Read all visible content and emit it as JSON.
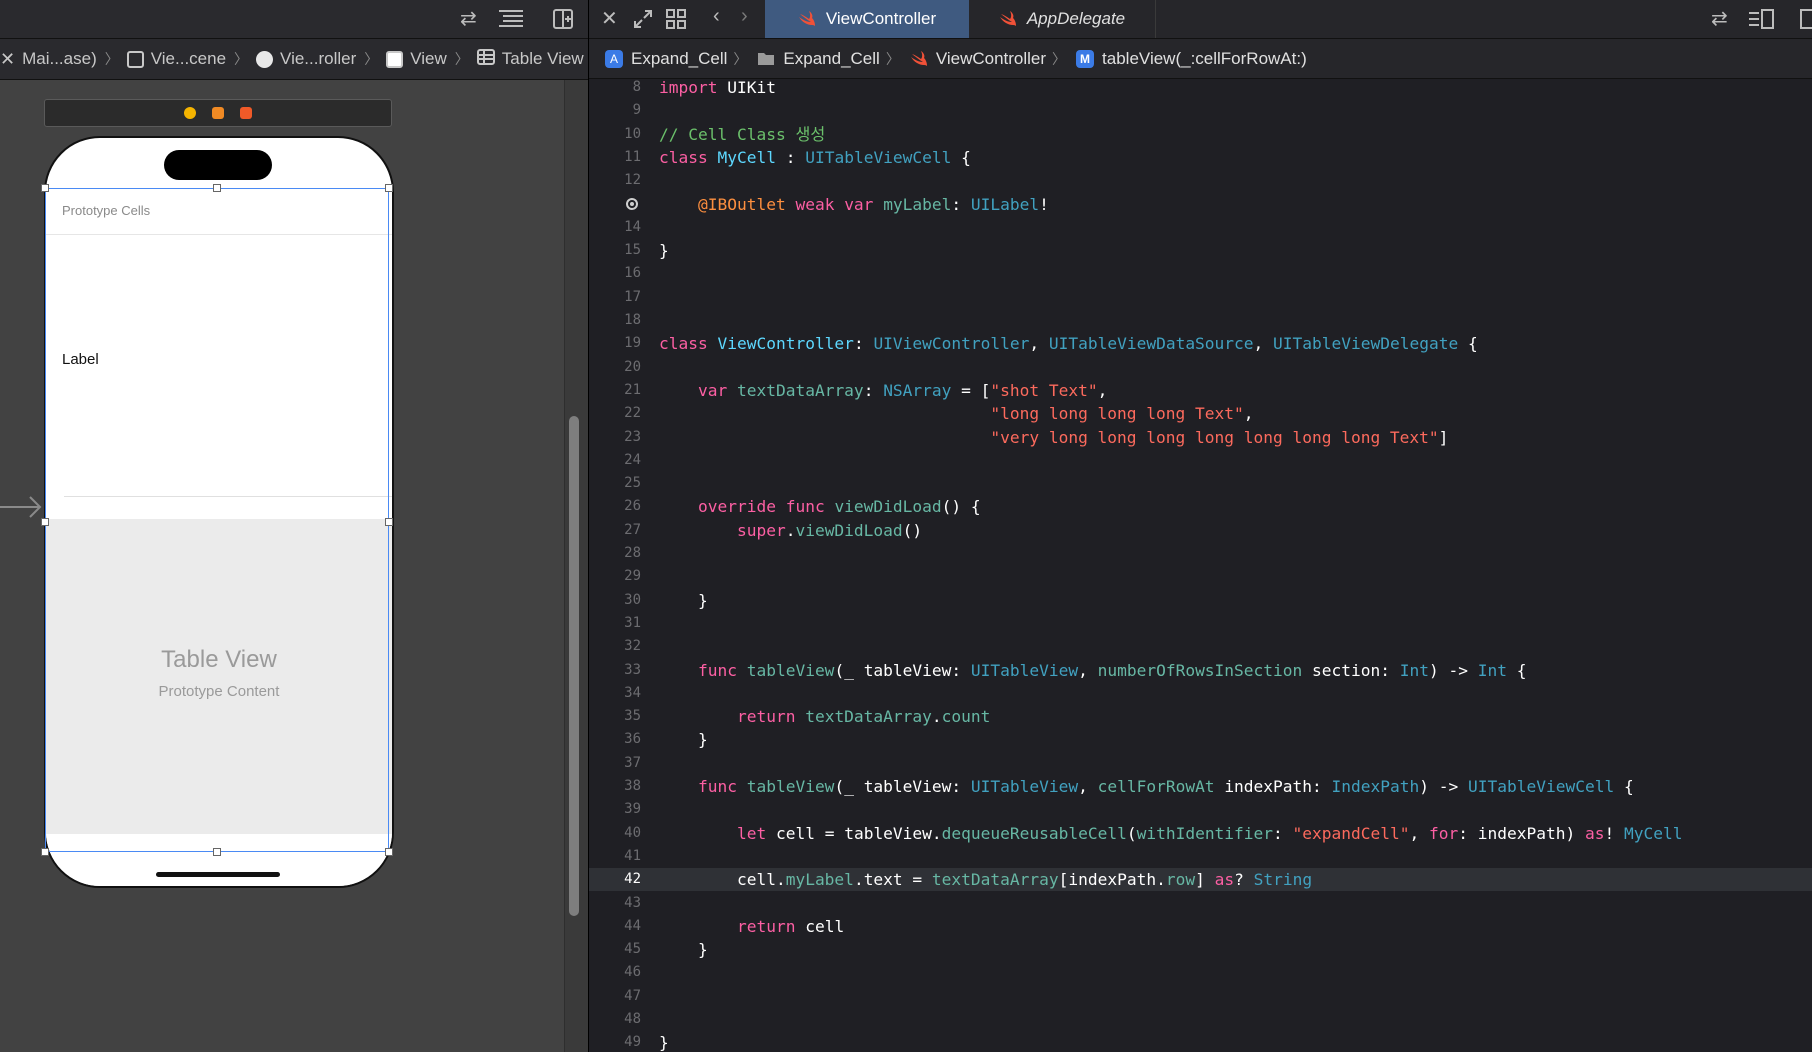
{
  "left_jumpbar": {
    "items": [
      "Mai...ase)",
      "Vie...cene",
      "Vie...roller",
      "View",
      "Table View"
    ]
  },
  "storyboard": {
    "prototype_cells_header": "Prototype Cells",
    "cell_label": "Label",
    "table_view_title": "Table View",
    "table_view_subtitle": "Prototype Content"
  },
  "tabs": {
    "active": "ViewController",
    "inactive": "AppDelegate"
  },
  "right_jumpbar": {
    "items": [
      "Expand_Cell",
      "Expand_Cell",
      "ViewController",
      "tableView(_:cellForRowAt:)"
    ]
  },
  "editor": {
    "highlighted_line": 42,
    "lines": [
      {
        "n": "8",
        "t": "import UIKit"
      },
      {
        "n": "9",
        "t": ""
      },
      {
        "n": "10",
        "t": "// Cell Class 생성"
      },
      {
        "n": "11",
        "t": "class MyCell : UITableViewCell {"
      },
      {
        "n": "12",
        "t": ""
      },
      {
        "n": "13",
        "t": "    @IBOutlet weak var myLabel: UILabel!"
      },
      {
        "n": "14",
        "t": ""
      },
      {
        "n": "15",
        "t": "}"
      },
      {
        "n": "16",
        "t": ""
      },
      {
        "n": "17",
        "t": ""
      },
      {
        "n": "18",
        "t": ""
      },
      {
        "n": "19",
        "t": "class ViewController: UIViewController, UITableViewDataSource, UITableViewDelegate {"
      },
      {
        "n": "20",
        "t": ""
      },
      {
        "n": "21",
        "t": "    var textDataArray: NSArray = [\"shot Text\","
      },
      {
        "n": "22",
        "t": "                                  \"long long long long Text\","
      },
      {
        "n": "23",
        "t": "                                  \"very long long long long long long long Text\"]"
      },
      {
        "n": "24",
        "t": ""
      },
      {
        "n": "25",
        "t": ""
      },
      {
        "n": "26",
        "t": "    override func viewDidLoad() {"
      },
      {
        "n": "27",
        "t": "        super.viewDidLoad()"
      },
      {
        "n": "28",
        "t": ""
      },
      {
        "n": "29",
        "t": ""
      },
      {
        "n": "30",
        "t": "    }"
      },
      {
        "n": "31",
        "t": ""
      },
      {
        "n": "32",
        "t": ""
      },
      {
        "n": "33",
        "t": "    func tableView(_ tableView: UITableView, numberOfRowsInSection section: Int) -> Int {"
      },
      {
        "n": "34",
        "t": ""
      },
      {
        "n": "35",
        "t": "        return textDataArray.count"
      },
      {
        "n": "36",
        "t": "    }"
      },
      {
        "n": "37",
        "t": ""
      },
      {
        "n": "38",
        "t": "    func tableView(_ tableView: UITableView, cellForRowAt indexPath: IndexPath) -> UITableViewCell {"
      },
      {
        "n": "39",
        "t": ""
      },
      {
        "n": "40",
        "t": "        let cell = tableView.dequeueReusableCell(withIdentifier: \"expandCell\", for: indexPath) as! MyCell"
      },
      {
        "n": "41",
        "t": ""
      },
      {
        "n": "42",
        "t": "        cell.myLabel.text = textDataArray[indexPath.row] as? String"
      },
      {
        "n": "43",
        "t": ""
      },
      {
        "n": "44",
        "t": "        return cell"
      },
      {
        "n": "45",
        "t": "    }"
      },
      {
        "n": "46",
        "t": ""
      },
      {
        "n": "47",
        "t": ""
      },
      {
        "n": "48",
        "t": ""
      },
      {
        "n": "49",
        "t": "}"
      }
    ],
    "breakpoint_line": "13"
  },
  "icons": {
    "left_toolbar": [
      "swap-arrows-icon",
      "lines-icon",
      "add-editor-icon"
    ],
    "right_toolbar": [
      "close-icon",
      "expand-icon",
      "grid-icon",
      "back-icon",
      "forward-icon"
    ],
    "right_corner": [
      "swap-arrows-icon",
      "inspector-icon",
      "sidebar-icon"
    ]
  },
  "colors": {
    "active_tab": "#3f5a80",
    "keyword": "#fc5fa3",
    "comment": "#6bc06b",
    "type": "#5dd8ff",
    "string": "#fc6a5d"
  }
}
